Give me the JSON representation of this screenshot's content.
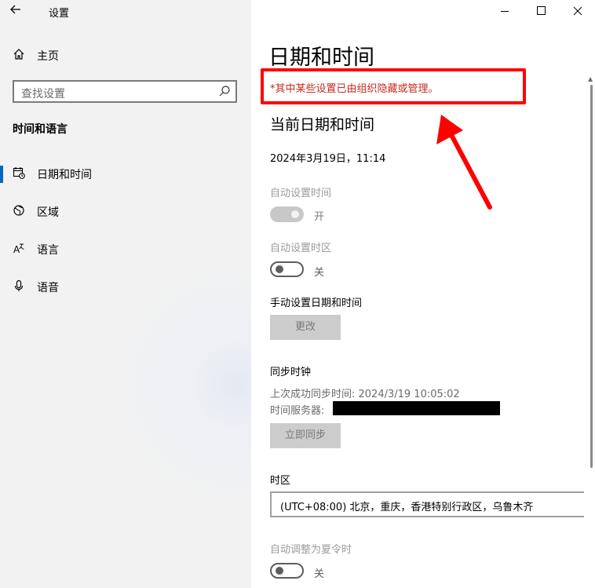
{
  "window": {
    "app_title": "设置",
    "minimize_glyph": "—",
    "maximize_glyph": "☐",
    "close_glyph": "✕"
  },
  "sidebar": {
    "home_label": "主页",
    "search_placeholder": "查找设置",
    "section_title": "时间和语言",
    "items": [
      {
        "label": "日期和时间",
        "icon": "calendar-clock-icon",
        "selected": true
      },
      {
        "label": "区域",
        "icon": "globe-icon",
        "selected": false
      },
      {
        "label": "语言",
        "icon": "language-icon",
        "selected": false
      },
      {
        "label": "语音",
        "icon": "microphone-icon",
        "selected": false
      }
    ]
  },
  "main": {
    "page_title": "日期和时间",
    "managed_notice": "*其中某些设置已由组织隐藏或管理。",
    "current_section_title": "当前日期和时间",
    "current_datetime": "2024年3月19日，11:14",
    "auto_time": {
      "label": "自动设置时间",
      "state": "开",
      "on": true,
      "enabled": false
    },
    "auto_timezone": {
      "label": "自动设置时区",
      "state": "关",
      "on": false
    },
    "manual": {
      "label": "手动设置日期和时间",
      "button": "更改"
    },
    "sync": {
      "title": "同步时钟",
      "last_sync": "上次成功同步时间: 2024/3/19 10:05:02",
      "server_label": "时间服务器:",
      "button": "立即同步"
    },
    "timezone": {
      "label": "时区",
      "value": "(UTC+08:00) 北京，重庆，香港特别行政区，乌鲁木齐"
    },
    "dst": {
      "label": "自动调整为夏令时",
      "state": "关",
      "on": false
    }
  },
  "colors": {
    "accent": "#0067c0",
    "notice_text": "#c42b1c",
    "annotation_red": "#ff0000"
  }
}
